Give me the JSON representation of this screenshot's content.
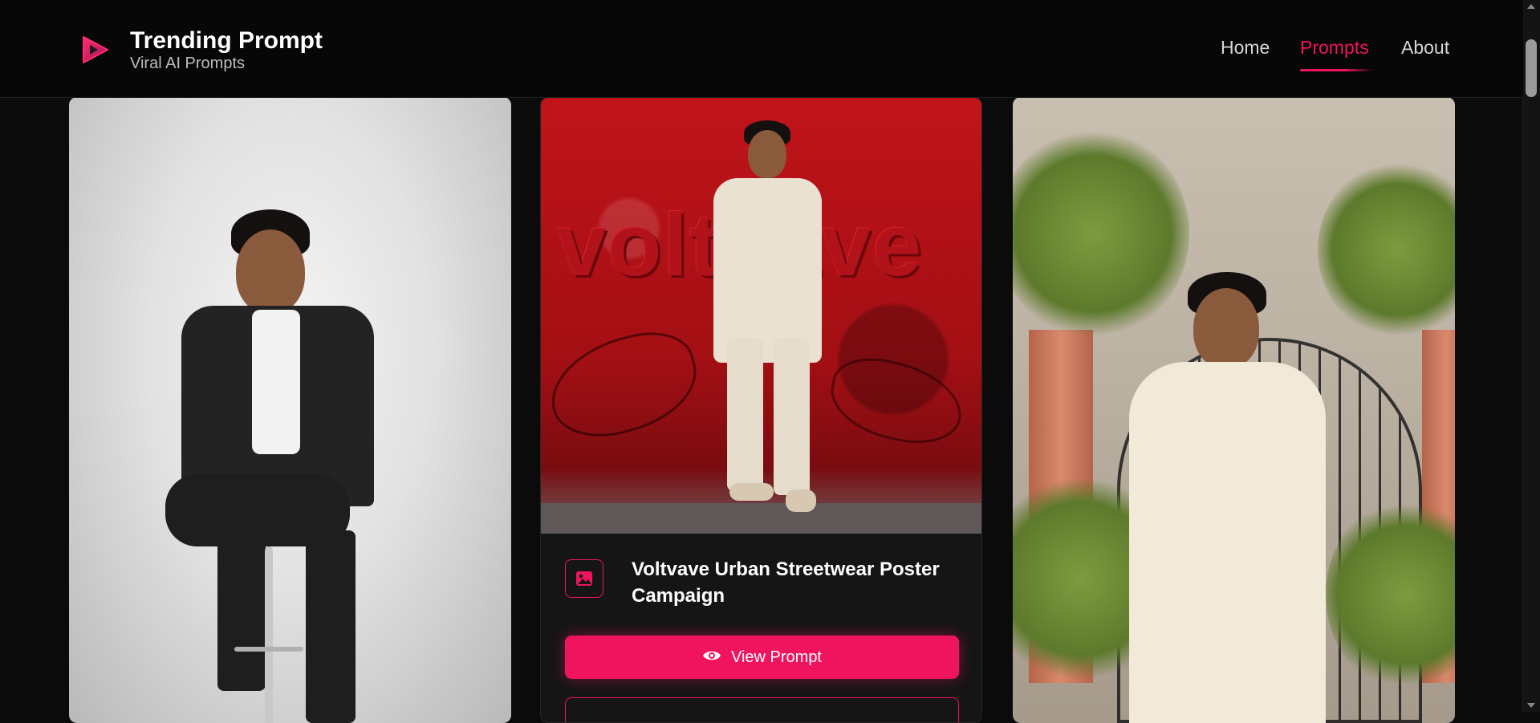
{
  "header": {
    "title": "Trending Prompt",
    "subtitle": "Viral AI Prompts",
    "logo_icon": "play-logo-icon"
  },
  "nav": {
    "items": [
      {
        "label": "Home",
        "active": false
      },
      {
        "label": "Prompts",
        "active": true
      },
      {
        "label": "About",
        "active": false
      }
    ]
  },
  "cards": [
    {
      "image": "man-in-black-suit-on-bar-stool"
    },
    {
      "image": "man-in-cream-outfit-against-red-voltvave-wall",
      "wall_text": "voltvave",
      "title": "Voltvave Urban Streetwear Poster Campaign",
      "icon": "image-icon",
      "button_label": "View Prompt",
      "button_icon": "eye-icon"
    },
    {
      "image": "man-in-white-kurta-courtyard-gate"
    }
  ],
  "colors": {
    "accent": "#f0145e",
    "background": "#0b0b0b",
    "header_bg": "#070707",
    "card_bg": "#151515"
  }
}
